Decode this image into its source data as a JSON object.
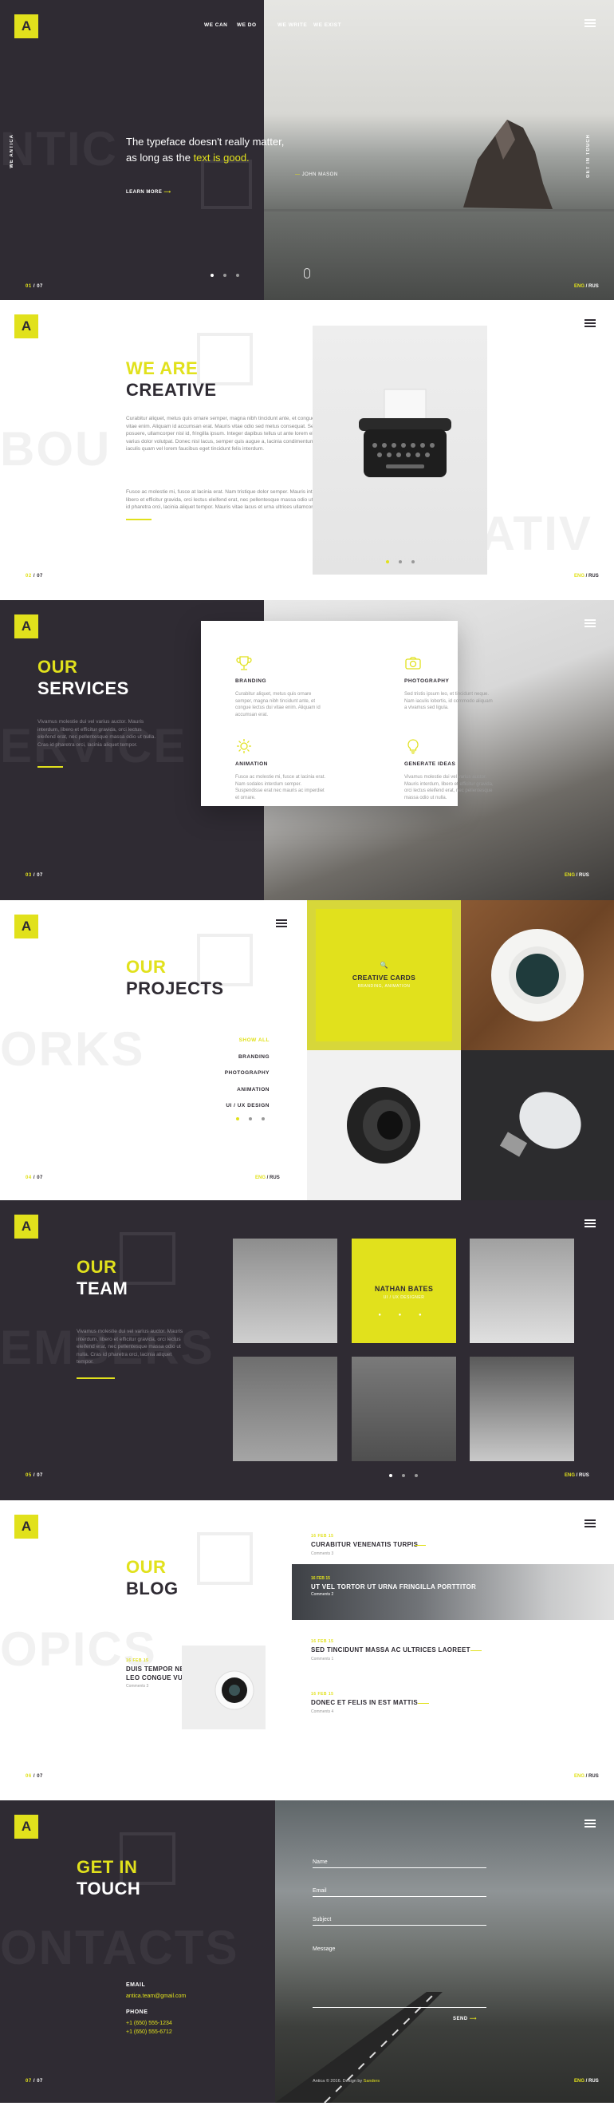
{
  "brand": {
    "logo_letter": "A",
    "accent": "#e1e11c",
    "dark": "#2f2b33"
  },
  "hero": {
    "nav_left": [
      "WE CAN",
      "WE DO"
    ],
    "nav_right": [
      "WE WRITE",
      "WE EXIST"
    ],
    "ghost": "NTIC",
    "vertical_left": "WE ANTICA",
    "vertical_right": "GET IN TOUCH",
    "quote_line1": "The typeface doesn't really matter,",
    "quote_line2_pre": "as long as the ",
    "quote_line2_hl": "text is good.",
    "cite": "JOHN MASON",
    "learn_more": "LEARN MORE",
    "pager_cur": "01",
    "pager_total": "07",
    "lang_on": "ENG",
    "lang_off": "RUS"
  },
  "about": {
    "title1": "WE ARE",
    "title2": "CREATIVE",
    "ghost_left": "BOU",
    "ghost_right": "CREATIV",
    "para1": "Curabitur aliquet, metus quis ornare semper, magna nibh tincidunt ante, et congue lectus dui vitae enim. Aliquam id accumsan erat. Mauris vitae odio sed metus consequat. Sed sed felis posuere, ullamcorper nisl id, fringilla ipsum. Integer dapibus tellus ut ante lorem eleifend, nec varius dolor volutpat. Donec nisl lacus, semper quis augue a, lacinia condimentum diam. Nam iaculis quam vel lorem faucibus eget tincidunt felis interdum.",
    "para2": "Fusce ac molestie mi, fusce at lacinia erat. Nam tristique dolor semper. Mauris interdum, libero et efficitur gravida, orci lectus eleifend erat, nec pellentesque massa odio ut nulla. Cras id pharetra orci, lacinia aliquet tempor. Mauris vitae lacus et urna ultrices ullamcorper.",
    "pager_cur": "02",
    "pager_total": "07",
    "lang_on": "ENG",
    "lang_off": "RUS"
  },
  "services": {
    "title1": "OUR",
    "title2": "SERVICES",
    "ghost": "ERVICE",
    "intro": "Vivamus molestie dui vel varius auctor. Mauris interdum, libero et efficitur gravida, orci lectus eleifend erat, nec pellentesque massa odio ut nulla. Cras id pharetra orci, lacinia aliquet tempor.",
    "items": [
      {
        "name": "BRANDING",
        "icon": "trophy-icon",
        "text": "Curabitur aliquet, metus quis ornare semper, magna nibh tincidunt ante, et congue lectus dui vitae enim. Aliquam id accumsan erat."
      },
      {
        "name": "PHOTOGRAPHY",
        "icon": "camera-icon",
        "text": "Sed tristis ipsum leo, et tincidunt neque. Nam iaculis lobortis, id commodo aliquam a vivamus sed ligula."
      },
      {
        "name": "ANIMATION",
        "icon": "gear-icon",
        "text": "Fusce ac molestie mi, fusce at lacinia erat. Nam sodales interdum semper. Suspendisse erat nec mauris ac imperdiet et ornare."
      },
      {
        "name": "GENERATE IDEAS",
        "icon": "lightbulb-icon",
        "text": "Vivamus molestie dui vel varius auctor. Mauris interdum, libero et efficitur gravida, orci lectus eleifend erat, nec pellentesque massa odio ut nulla."
      }
    ],
    "pager_cur": "03",
    "pager_total": "07",
    "lang_on": "ENG",
    "lang_off": "RUS"
  },
  "projects": {
    "title1": "OUR",
    "title2": "PROJECTS",
    "ghost": "ORKS",
    "filters": [
      "SHOW ALL",
      "BRANDING",
      "PHOTOGRAPHY",
      "ANIMATION",
      "UI / UX DESIGN"
    ],
    "featured_title": "CREATIVE CARDS",
    "featured_sub": "BRANDING, ANIMATION",
    "pager_cur": "04",
    "pager_total": "07",
    "lang_on": "ENG",
    "lang_off": "RUS"
  },
  "team": {
    "title1": "OUR",
    "title2": "TEAM",
    "ghost": "EMBERS",
    "intro": "Vivamus molestie dui vel varius auctor. Mauris interdum, libero et efficitur gravida, orci lectus eleifend erat, nec pellentesque massa odio ut nulla. Cras id pharetra orci, lacinia aliquet tempor.",
    "featured_name": "NATHAN BATES",
    "featured_role": "UI / UX DESIGNER",
    "pager_cur": "05",
    "pager_total": "07",
    "lang_on": "ENG",
    "lang_off": "RUS"
  },
  "blog": {
    "title1": "OUR",
    "title2": "BLOG",
    "ghost": "OPICS",
    "posts": [
      {
        "date": "16 FEB 15",
        "title": "CURABITUR VENENATIS TURPIS",
        "comments": "Comments 3"
      },
      {
        "date": "16 FEB 15",
        "title": "UT VEL TORTOR UT URNA FRINGILLA PORTTITOR",
        "comments": "Comments 2"
      },
      {
        "date": "16 FEB 15",
        "title": "SED TINCIDUNT MASSA AC ULTRICES LAOREET",
        "comments": "Comments 1"
      },
      {
        "date": "16 FEB 15",
        "title": "DONEC ET FELIS IN EST MATTIS",
        "comments": "Comments 4"
      }
    ],
    "side_post": {
      "date": "16 FEB 15",
      "title": "DUIS TEMPOR NEQUE ID LEO CONGUE VULPUTATE",
      "comments": "Comments 3"
    },
    "pager_cur": "06",
    "pager_total": "07",
    "lang_on": "ENG",
    "lang_off": "RUS"
  },
  "contact": {
    "title1": "GET IN",
    "title2": "TOUCH",
    "ghost": "ONTACTS",
    "email_label": "EMAIL",
    "email": "antica.team@gmail.com",
    "phone_label": "PHONE",
    "phone1": "+1 (650) 555-1234",
    "phone2": "+1 (650) 555-6712",
    "fields": {
      "name": "Name",
      "email": "Email",
      "subject": "Subject",
      "message": "Message"
    },
    "send": "SEND",
    "copyright_pre": "Antica © 2016. Design by ",
    "copyright_by": "Sanders",
    "pager_cur": "07",
    "pager_total": "07",
    "lang_on": "ENG",
    "lang_off": "RUS"
  }
}
